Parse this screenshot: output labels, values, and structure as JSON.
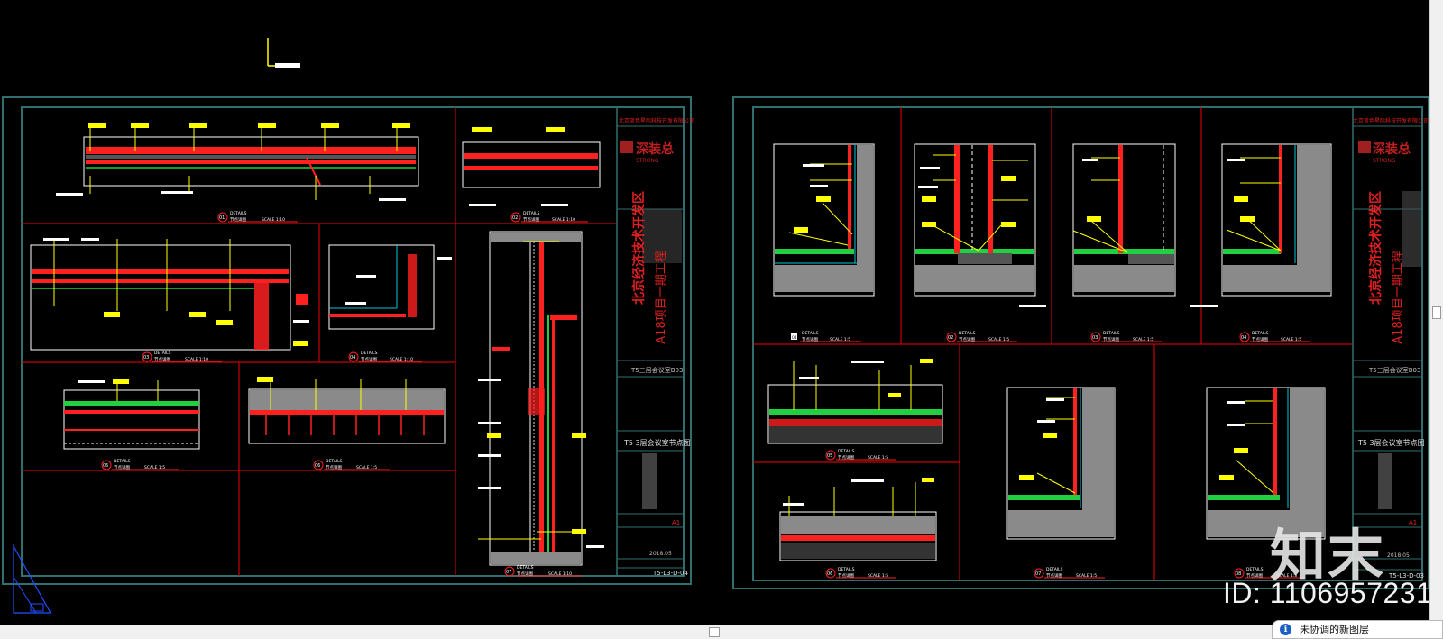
{
  "sheet_left": {
    "company": "北京蓝色星际科技开发有限公司",
    "logo_name": "深装总",
    "logo_en": "STRONG",
    "project_line1": "北京经济技术开发区",
    "project_line2": "A18项目一期工程",
    "area_label": "T5三层会议室B03",
    "drawing_title": "T5 3层会议室节点图",
    "scale_box": "A1",
    "date": "2018.05",
    "sheet_no": "T5-L3-D-04",
    "details": [
      {
        "no": "01",
        "label": "DETAILS",
        "name": "节点详图",
        "scale": "SCALE 1:10"
      },
      {
        "no": "02",
        "label": "DETAILS",
        "name": "节点详图",
        "scale": "SCALE 1:10"
      },
      {
        "no": "03",
        "label": "DETAILS",
        "name": "节点详图",
        "scale": "SCALE 1:10"
      },
      {
        "no": "04",
        "label": "DETAILS",
        "name": "节点详图",
        "scale": "SCALE 1:10"
      },
      {
        "no": "05",
        "label": "DETAILS",
        "name": "节点详图",
        "scale": "SCALE 1:5"
      },
      {
        "no": "06",
        "label": "DETAILS",
        "name": "节点详图",
        "scale": "SCALE 1:5"
      },
      {
        "no": "07",
        "label": "DETAILS",
        "name": "节点详图",
        "scale": "SCALE 1:10"
      }
    ]
  },
  "sheet_right": {
    "company": "北京蓝色星际科技开发有限公司",
    "logo_name": "深装总",
    "logo_en": "STRONG",
    "project_line1": "北京经济技术开发区",
    "project_line2": "A18项目一期工程",
    "area_label": "T5三层会议室B03",
    "drawing_title": "T5 3层会议室节点图",
    "scale_box": "A1",
    "date": "2018.05",
    "sheet_no": "T5-L3-D-03",
    "details": [
      {
        "no": "01",
        "label": "DETAILS",
        "name": "节点详图",
        "scale": "SCALE 1:5"
      },
      {
        "no": "02",
        "label": "DETAILS",
        "name": "节点详图",
        "scale": "SCALE 1:5"
      },
      {
        "no": "03",
        "label": "DETAILS",
        "name": "节点详图",
        "scale": "SCALE 1:5"
      },
      {
        "no": "04",
        "label": "DETAILS",
        "name": "节点详图",
        "scale": "SCALE 1:5"
      },
      {
        "no": "05",
        "label": "DETAILS",
        "name": "节点详图",
        "scale": "SCALE 1:5"
      },
      {
        "no": "06",
        "label": "DETAILS",
        "name": "节点详图",
        "scale": "SCALE 1:5"
      },
      {
        "no": "07",
        "label": "DETAILS",
        "name": "节点详图",
        "scale": "SCALE 1:5"
      },
      {
        "no": "08",
        "label": "DETAILS",
        "name": "节点详图",
        "scale": "SCALE 1:5"
      }
    ]
  },
  "watermark": {
    "brand": "知末",
    "image_id": "ID: 1106957231"
  },
  "status": {
    "notification": "未协调的新图层"
  },
  "colors": {
    "background": "#000000",
    "frame": "#2f6f6f",
    "grid": "#d40000",
    "annotation": "#ffff00",
    "detail": "#ff2020",
    "cyan": "#00c8d8",
    "green": "#20d040",
    "fill": "#8a8a8a"
  }
}
